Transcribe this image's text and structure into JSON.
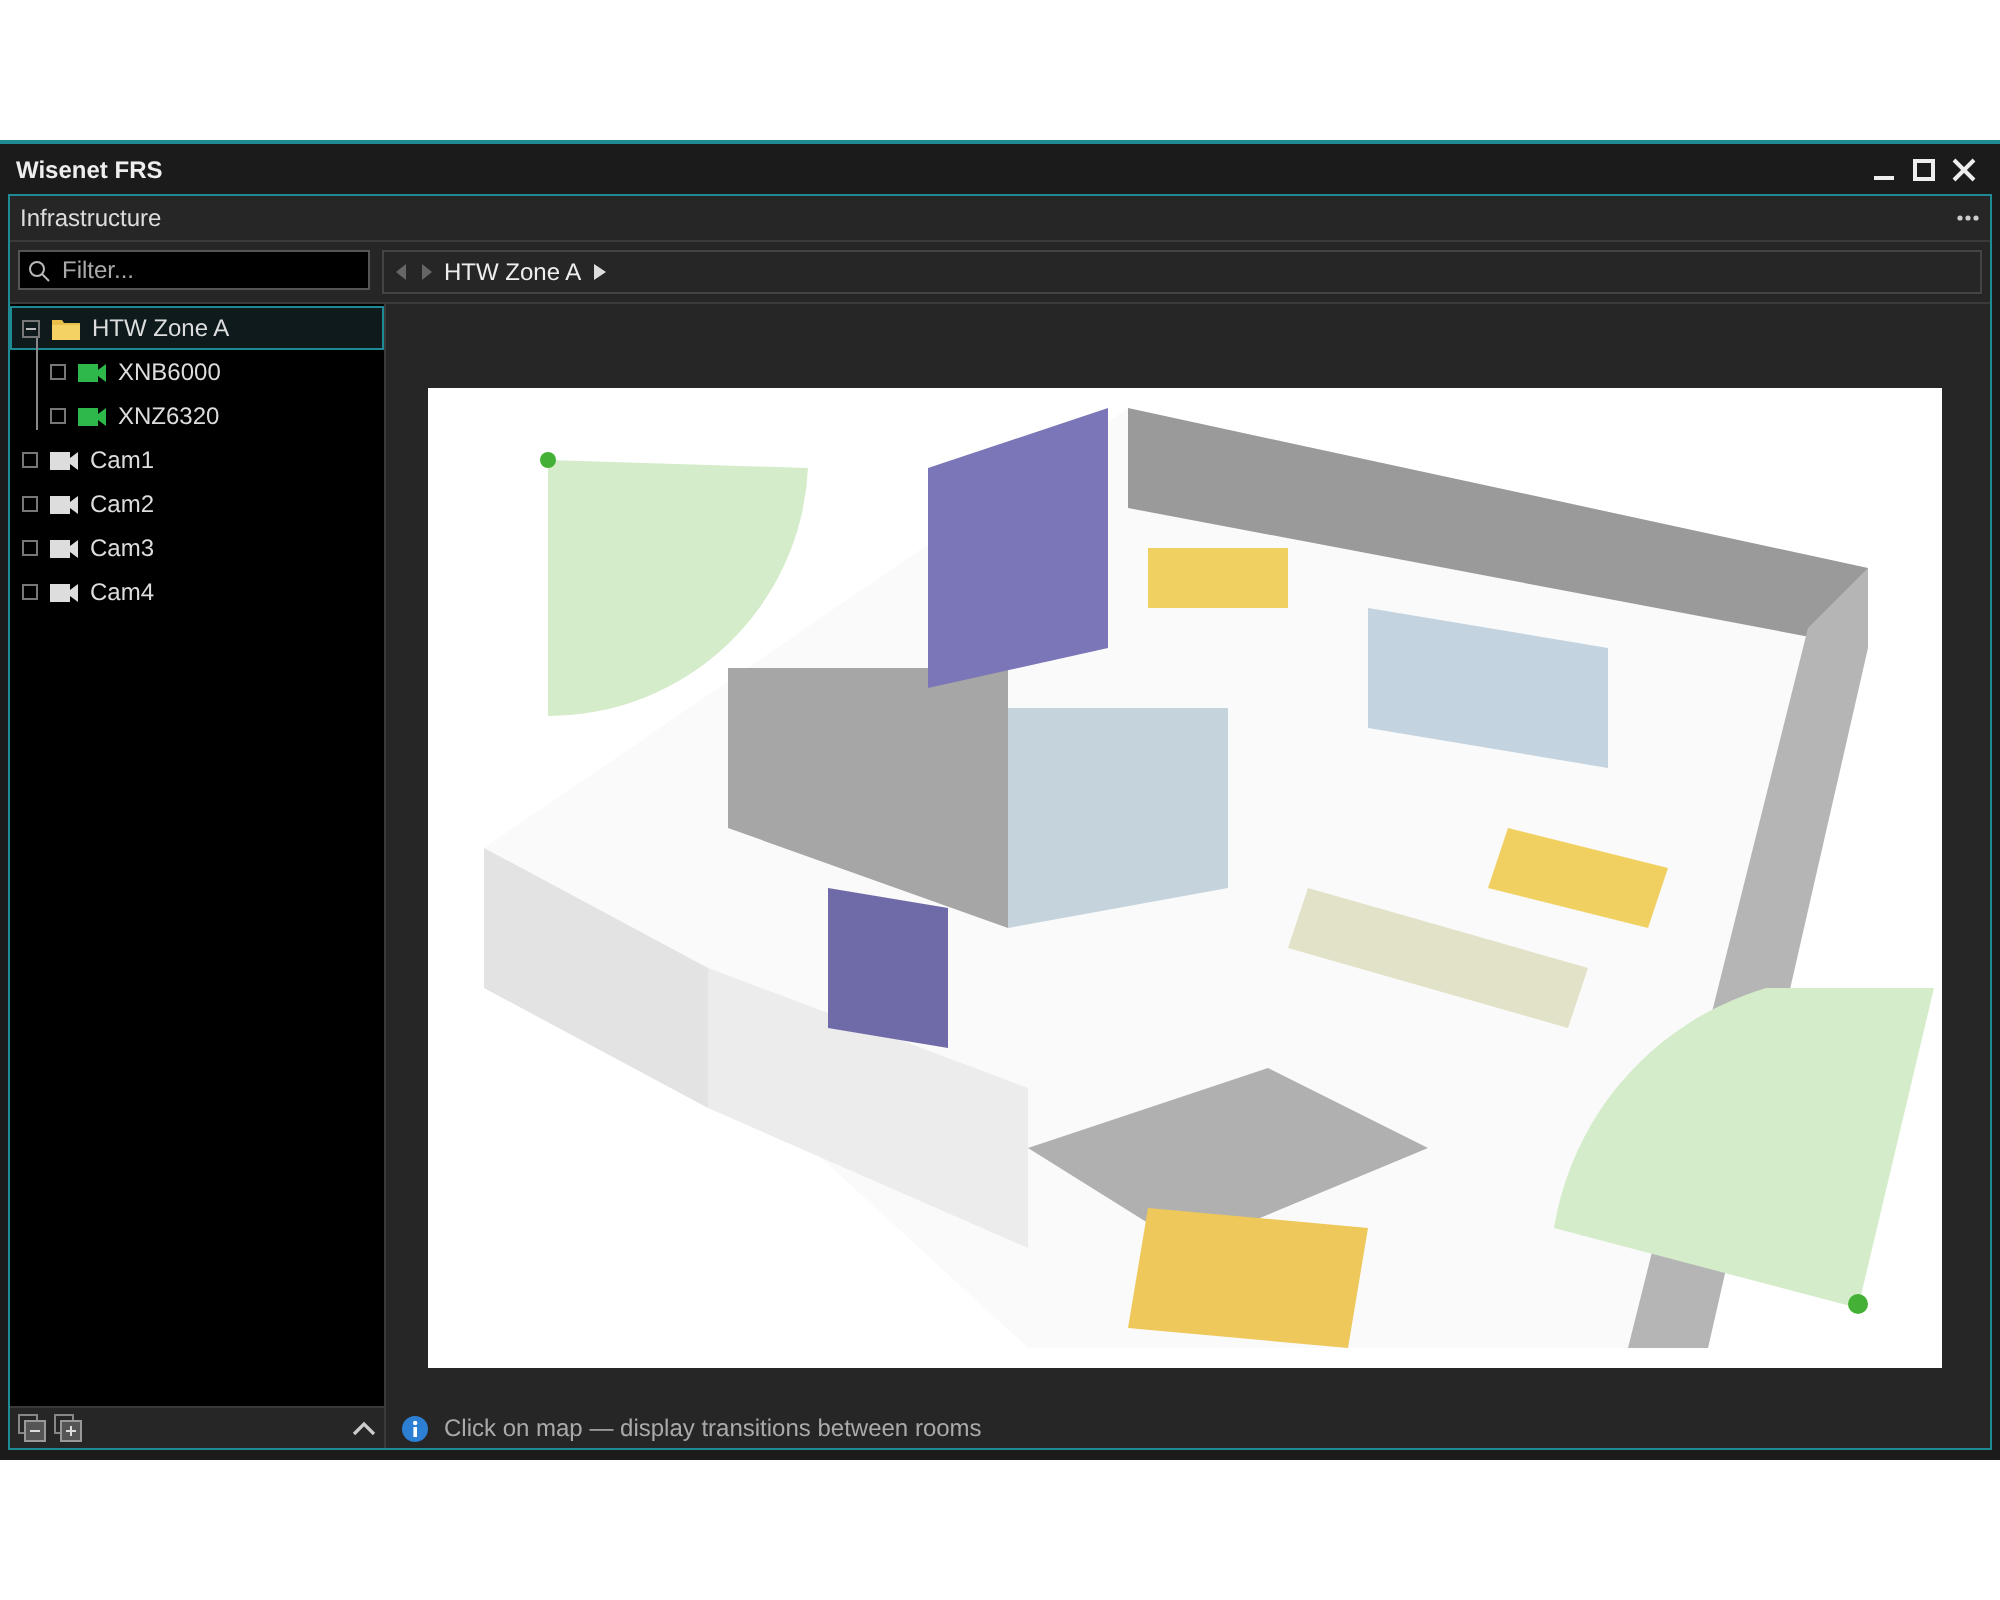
{
  "window": {
    "title": "Wisenet FRS"
  },
  "panel": {
    "title": "Infrastructure"
  },
  "filter": {
    "placeholder": "Filter..."
  },
  "breadcrumb": {
    "items": [
      "HTW Zone A"
    ]
  },
  "tree": [
    {
      "label": "HTW Zone A",
      "kind": "folder",
      "expanded": true,
      "selected": true,
      "children": [
        {
          "label": "XNB6000",
          "kind": "camera",
          "online": true,
          "checked": false,
          "selected": false
        },
        {
          "label": "XNZ6320",
          "kind": "camera",
          "online": true,
          "checked": false,
          "selected": false
        }
      ]
    },
    {
      "label": "Cam1",
      "kind": "camera",
      "online": false,
      "checked": false,
      "selected": false
    },
    {
      "label": "Cam2",
      "kind": "camera",
      "online": false,
      "checked": false,
      "selected": false
    },
    {
      "label": "Cam3",
      "kind": "camera",
      "online": false,
      "checked": false,
      "selected": false
    },
    {
      "label": "Cam4",
      "kind": "camera",
      "online": false,
      "checked": false,
      "selected": false
    }
  ],
  "status": {
    "text": "Click on map — display transitions between rooms"
  }
}
